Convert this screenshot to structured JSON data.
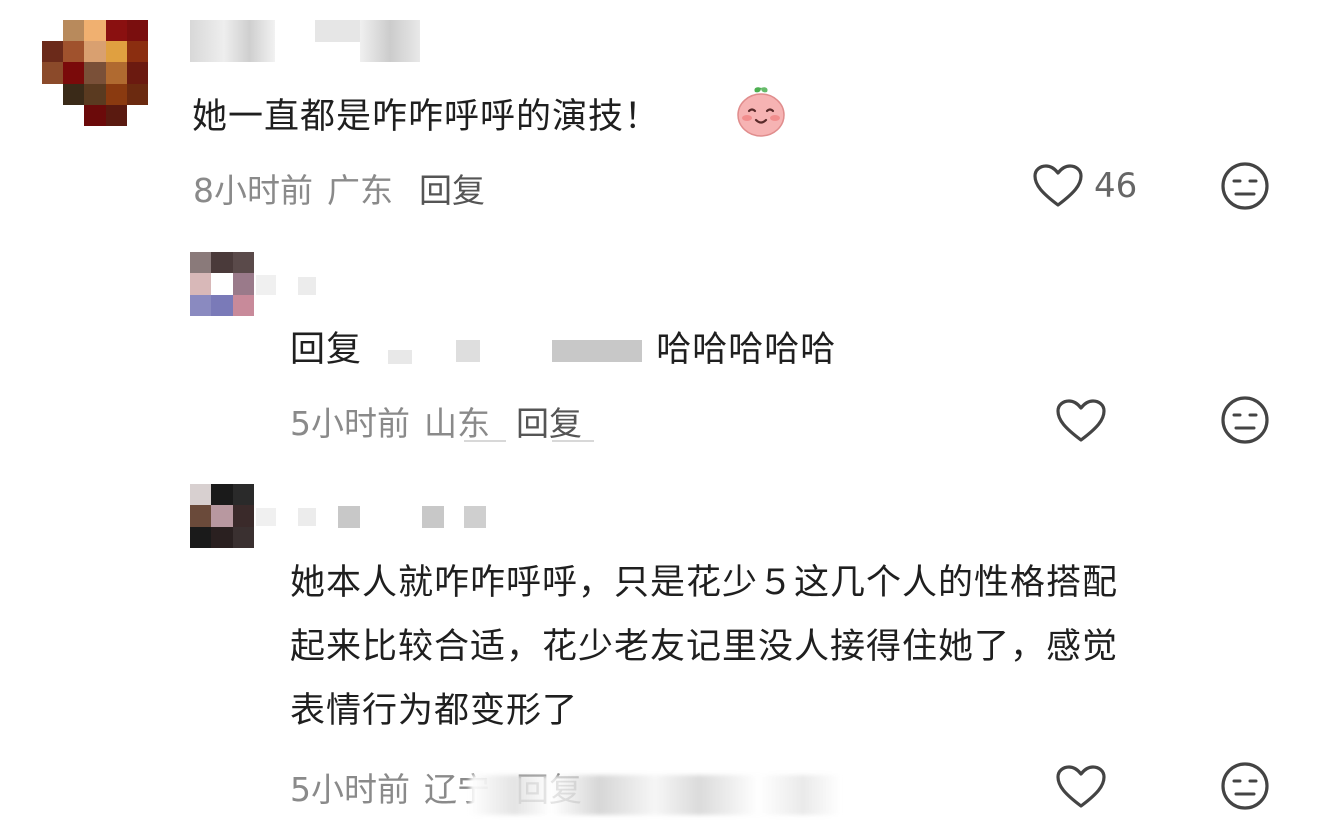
{
  "comments": [
    {
      "text": "她一直都是咋咋呼呼的演技！",
      "emoji": "smiling-face-emoji",
      "time": "8小时前",
      "region": "广东",
      "reply_label": "回复",
      "like_count": "46",
      "like_icon": "heart-outline-icon",
      "dislike_icon": "meh-face-icon"
    },
    {
      "reply_prefix": "回复",
      "text": "哈哈哈哈哈",
      "time": "5小时前",
      "region": "山东",
      "reply_label": "回复",
      "like_icon": "heart-outline-icon",
      "dislike_icon": "meh-face-icon"
    },
    {
      "lines": [
        "她本人就咋咋呼呼，只是花少５这几个人的性格搭配",
        "起来比较合适，花少老友记里没人接得住她了，感觉",
        "表情行为都变形了"
      ],
      "time": "5小时前",
      "region": "辽宁",
      "reply_label": "回复",
      "like_icon": "heart-outline-icon",
      "dislike_icon": "meh-face-icon"
    }
  ],
  "colors": {
    "text": "#1f1f1f",
    "meta": "#8a8a8a",
    "icon": "#444444"
  }
}
